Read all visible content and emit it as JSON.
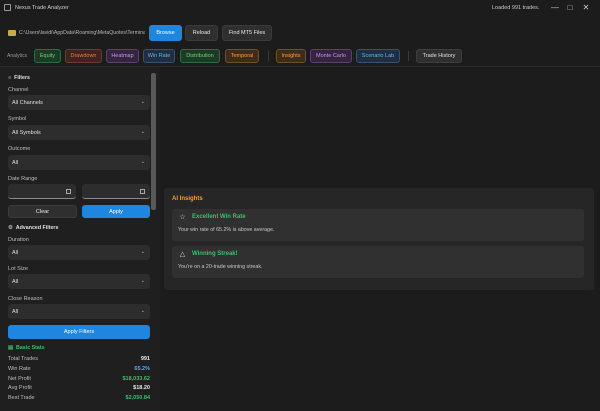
{
  "window": {
    "title": "Nexus Trade Analyzer",
    "status": "Loaded 991 trades."
  },
  "toolbar": {
    "path": "C:\\Users\\lavidi\\AppData\\Roaming\\MetaQuotes\\Termina...",
    "browse": "Browse",
    "reload": "Reload",
    "find_mt5": "Find MT5 Files"
  },
  "analytics": {
    "label": "Analytics",
    "chips": [
      "Equity",
      "Drawdown",
      "Heatmap",
      "Win Rate",
      "Distribution",
      "Temporal",
      "Insights",
      "Monte Carlo",
      "Scenario Lab",
      "Trade History"
    ]
  },
  "filters": {
    "title": "Filters",
    "channel_label": "Channel",
    "channel_value": "All Channels",
    "symbol_label": "Symbol",
    "symbol_value": "All Symbols",
    "outcome_label": "Outcome",
    "outcome_value": "All",
    "date_label": "Date Range",
    "clear": "Clear",
    "apply": "Apply"
  },
  "advanced": {
    "title": "Advanced Filters",
    "duration_label": "Duration",
    "duration_value": "All",
    "lot_label": "Lot Size",
    "lot_value": "All",
    "close_label": "Close Reason",
    "close_value": "All",
    "apply_filters": "Apply Filters"
  },
  "stats": {
    "title": "Basic Stats",
    "rows": [
      {
        "label": "Total Trades",
        "value": "991",
        "color": "#e8e8e8"
      },
      {
        "label": "Win Rate",
        "value": "65.2%",
        "color": "#5aa9f0"
      },
      {
        "label": "Net Profit",
        "value": "$18,033.62",
        "color": "#3fbf6a"
      },
      {
        "label": "Avg Profit",
        "value": "$18.20",
        "color": "#e8e8e8"
      },
      {
        "label": "Best Trade",
        "value": "$2,050.84",
        "color": "#3fbf6a"
      }
    ]
  },
  "insights": {
    "title": "AI Insights",
    "cards": [
      {
        "title": "Excellent Win Rate",
        "text": "Your win rate of 65.2% is above average."
      },
      {
        "title": "Winning Streak!",
        "text": "You're on a 20-trade winning streak."
      }
    ]
  },
  "colors": {
    "accent": "#1f86e0",
    "insights_title": "#e8a33a",
    "positive": "#3fbf6a"
  }
}
